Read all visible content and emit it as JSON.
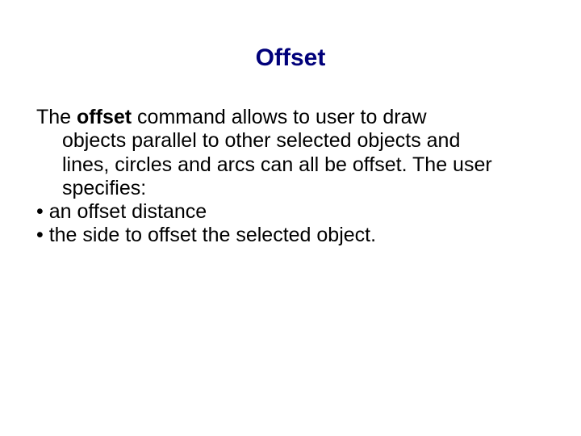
{
  "title": "Offset",
  "body": {
    "lead_word": "The ",
    "command_word": "offset",
    "para_after1": " command allows to user to draw",
    "para_line2": "objects parallel to other selected objects and",
    "para_line3": "lines, circles and arcs can all be offset. The user",
    "para_line4": "specifies:",
    "bullet1": "• an offset distance",
    "bullet2": "• the side to offset the selected object."
  }
}
